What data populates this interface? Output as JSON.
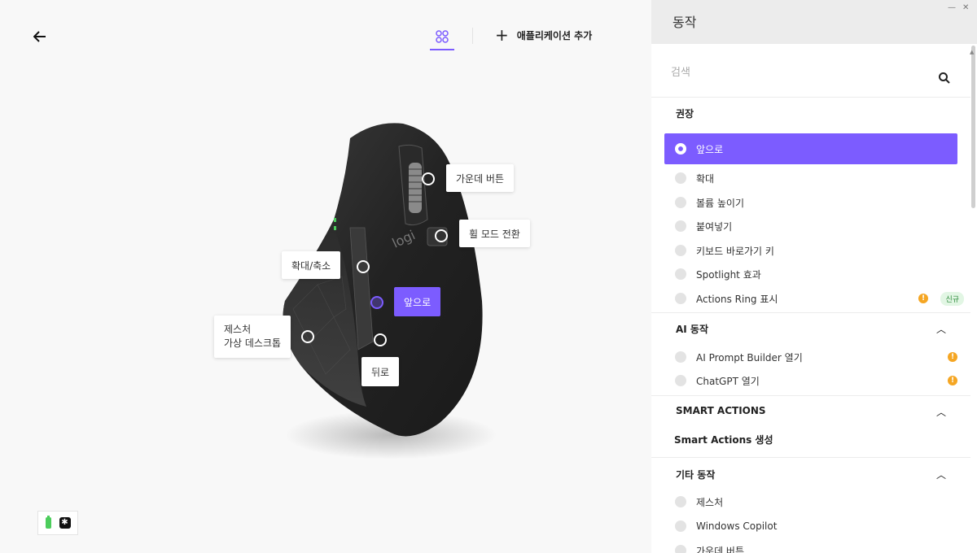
{
  "topbar": {
    "add_app_label": "애플리케이션 추가"
  },
  "mouse": {
    "brand_logo": "logi",
    "callouts": {
      "middle_button": "가운데 버튼",
      "wheel_mode": "휠 모드 전환",
      "zoom": "확대/축소",
      "forward": "앞으로",
      "gesture_line1": "제스처",
      "gesture_line2": "가상 데스크톱",
      "back": "뒤로"
    }
  },
  "panel": {
    "title": "동작",
    "search_placeholder": "검색",
    "recommended": {
      "title": "권장",
      "items": [
        {
          "label": "앞으로",
          "selected": true
        },
        {
          "label": "확대"
        },
        {
          "label": "볼륨 높이기"
        },
        {
          "label": "붙여넣기"
        },
        {
          "label": "키보드 바로가기 키"
        },
        {
          "label": "Spotlight 효과"
        },
        {
          "label": "Actions Ring 표시",
          "badge": "신규"
        }
      ]
    },
    "ai": {
      "title": "AI 동작",
      "items": [
        {
          "label": "AI Prompt Builder 열기"
        },
        {
          "label": "ChatGPT 열기"
        }
      ]
    },
    "smart": {
      "title": "SMART ACTIONS",
      "item": "Smart Actions 생성"
    },
    "other": {
      "title": "기타 동작",
      "items": [
        {
          "label": "제스처"
        },
        {
          "label": "Windows Copilot"
        },
        {
          "label": "가운데 버튼"
        }
      ]
    }
  },
  "colors": {
    "accent": "#7c5cff",
    "warning": "#f5a623",
    "new_badge_bg": "#e2f6e4"
  }
}
